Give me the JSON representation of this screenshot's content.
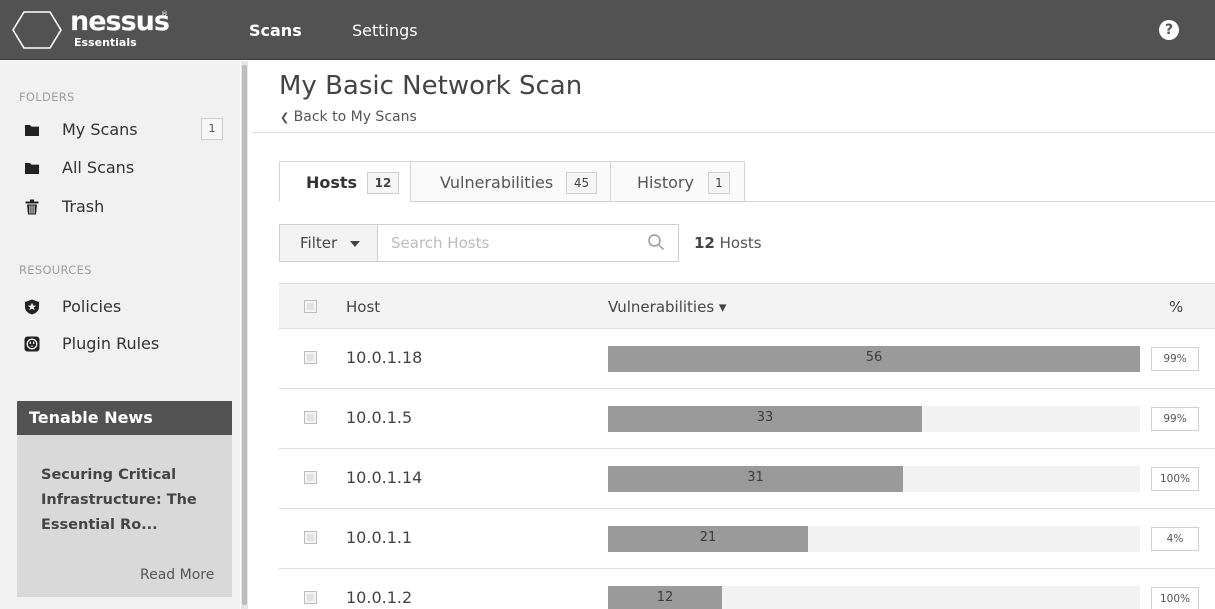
{
  "app": {
    "logo_name": "nessus",
    "logo_edition": "Essentials",
    "logo_mark": "®"
  },
  "topnav": {
    "items": [
      {
        "label": "Scans",
        "active": true
      },
      {
        "label": "Settings",
        "active": false
      }
    ],
    "help_label": "?"
  },
  "sidebar": {
    "folders_label": "FOLDERS",
    "folders": [
      {
        "label": "My Scans",
        "icon": "folder-icon",
        "badge": "1"
      },
      {
        "label": "All Scans",
        "icon": "folder-icon"
      },
      {
        "label": "Trash",
        "icon": "trash-icon"
      }
    ],
    "resources_label": "RESOURCES",
    "resources": [
      {
        "label": "Policies",
        "icon": "policy-shield-icon"
      },
      {
        "label": "Plugin Rules",
        "icon": "plugin-rules-icon"
      }
    ],
    "news": {
      "header": "Tenable News",
      "headline_lines": [
        "Securing Critical",
        "Infrastructure: The",
        "Essential Ro..."
      ],
      "read_more": "Read More"
    }
  },
  "scan": {
    "title": "My Basic Network Scan",
    "back_link": "Back to My Scans"
  },
  "tabs": [
    {
      "label": "Hosts",
      "count": "12",
      "active": true
    },
    {
      "label": "Vulnerabilities",
      "count": "45",
      "active": false
    },
    {
      "label": "History",
      "count": "1",
      "active": false
    }
  ],
  "toolbar": {
    "filter_label": "Filter",
    "search_placeholder": "Search Hosts",
    "count_number": "12",
    "count_label": "Hosts"
  },
  "table": {
    "columns": {
      "host": "Host",
      "vulnerabilities": "Vulnerabilities ▾",
      "percent": "%"
    },
    "max_vulns": 56,
    "rows": [
      {
        "host": "10.0.1.18",
        "vulns": 56,
        "percent": "99%"
      },
      {
        "host": "10.0.1.5",
        "vulns": 33,
        "percent": "99%"
      },
      {
        "host": "10.0.1.14",
        "vulns": 31,
        "percent": "100%"
      },
      {
        "host": "10.0.1.1",
        "vulns": 21,
        "percent": "4%"
      },
      {
        "host": "10.0.1.2",
        "vulns": 12,
        "percent": "100%"
      }
    ]
  },
  "colors": {
    "topbar": "#525252",
    "bar_fill": "#9a9a9a",
    "sidebar_bg": "#f1f1f1"
  }
}
